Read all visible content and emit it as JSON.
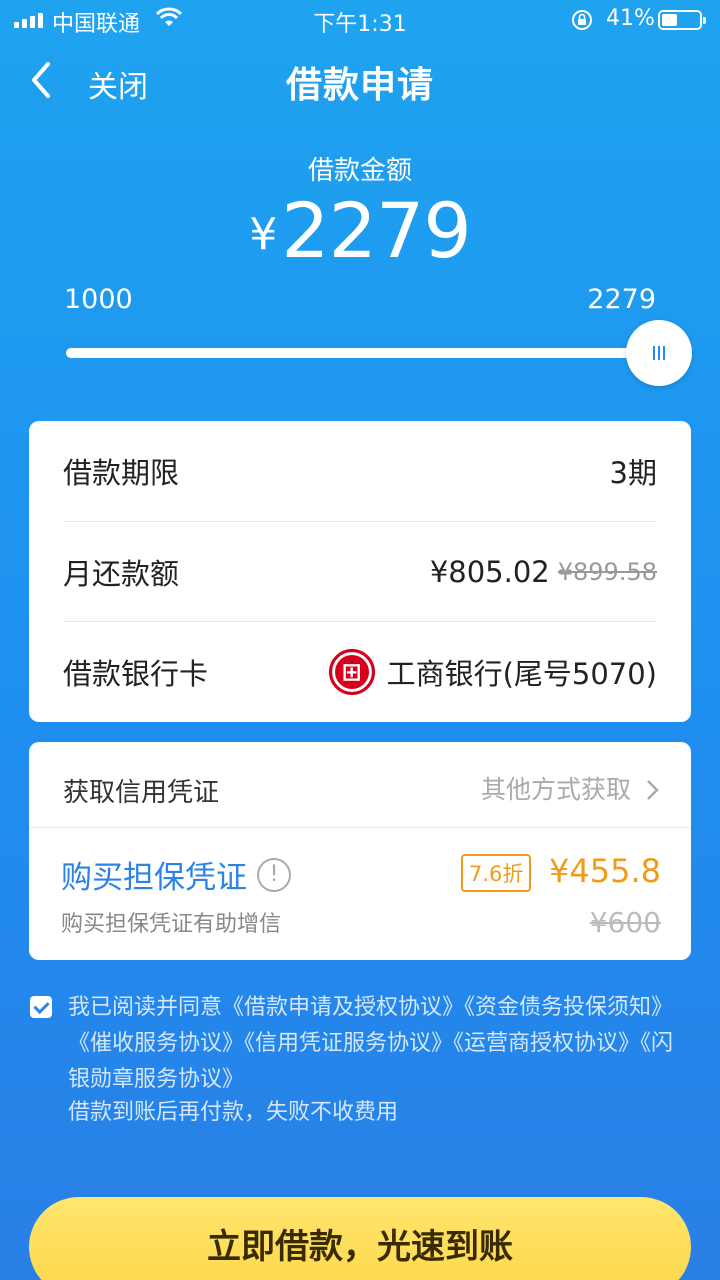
{
  "status_bar": {
    "carrier": "中国联通",
    "time": "下午1:31",
    "battery": "41%",
    "battery_level": 0.41
  },
  "nav": {
    "close_label": "关闭",
    "title": "借款申请"
  },
  "loan": {
    "amount_label": "借款金额",
    "currency": "¥",
    "amount": "2279",
    "slider_min": "1000",
    "slider_max": "2279",
    "slider_value": 1.0
  },
  "details": {
    "term_label": "借款期限",
    "term_value": "3期",
    "monthly_label": "月还款额",
    "monthly_value": "¥805.02",
    "monthly_original": "¥899.58",
    "bank_label": "借款银行卡",
    "bank_value": "工商银行(尾号5070)",
    "bank_color": "#d6001c"
  },
  "credential": {
    "title": "获取信用凭证",
    "other_methods": "其他方式获取",
    "buy_label": "购买担保凭证",
    "buy_desc": "购买担保凭证有助增信",
    "discount": "7.6折",
    "price": "¥455.8",
    "original_price": "¥600"
  },
  "agreement": {
    "checked": true,
    "text": "我已阅读并同意《借款申请及授权协议》《资金债务投保须知》《催收服务协议》《信用凭证服务协议》《运营商授权协议》《闪银勋章服务协议》",
    "note": "借款到账后再付款，失败不收费用"
  },
  "submit_label": "立即借款，光速到账",
  "colors": {
    "accent": "#1e8ff0",
    "price": "#f09c1a",
    "button": "#fcd64a"
  }
}
